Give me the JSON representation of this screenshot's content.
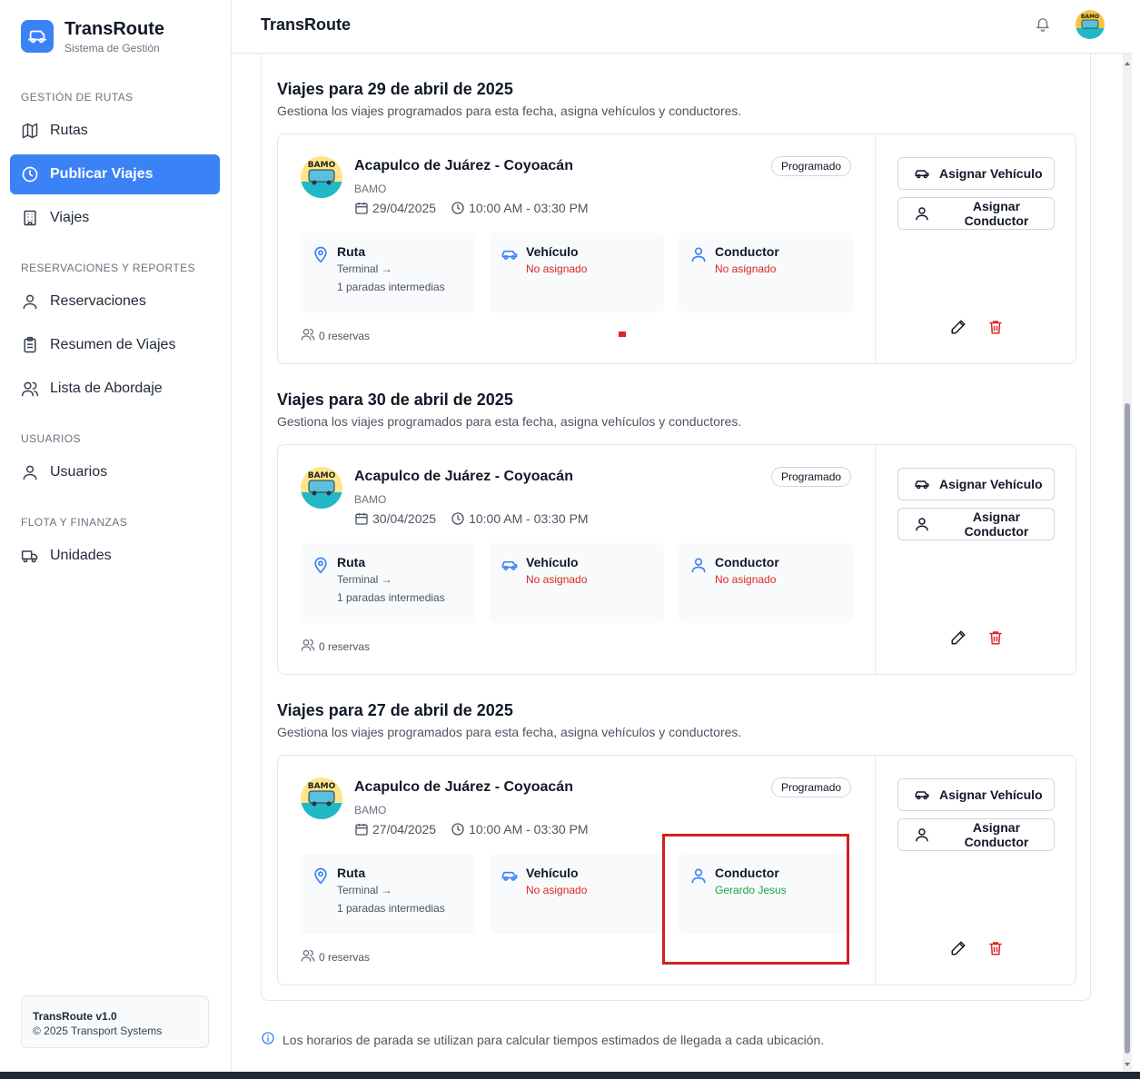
{
  "brand": {
    "title": "TransRoute",
    "subtitle": "Sistema de Gestión"
  },
  "sidebar": {
    "sections": [
      {
        "title": "GESTIÓN DE RUTAS",
        "items": [
          {
            "label": "Rutas",
            "icon": "map-icon"
          },
          {
            "label": "Publicar Viajes",
            "icon": "clock-icon",
            "active": true
          },
          {
            "label": "Viajes",
            "icon": "building-icon"
          }
        ]
      },
      {
        "title": "RESERVACIONES Y REPORTES",
        "items": [
          {
            "label": "Reservaciones",
            "icon": "user-icon"
          },
          {
            "label": "Resumen de Viajes",
            "icon": "clipboard-icon"
          },
          {
            "label": "Lista de Abordaje",
            "icon": "users-icon"
          }
        ]
      },
      {
        "title": "USUARIOS",
        "items": [
          {
            "label": "Usuarios",
            "icon": "user-icon"
          }
        ]
      },
      {
        "title": "FLOTA Y FINANZAS",
        "items": [
          {
            "label": "Unidades",
            "icon": "truck-icon"
          }
        ]
      }
    ],
    "version": {
      "line1": "TransRoute v1.0",
      "line2": "© 2025 Transport Systems"
    }
  },
  "topbar": {
    "title": "TransRoute"
  },
  "days": [
    {
      "title": "Viajes para 29 de abril de 2025",
      "subtitle": "Gestiona los viajes programados para esta fecha, asigna vehículos y conductores.",
      "trip": {
        "route": "Acapulco de Juárez - Coyoacán",
        "company": "BAMO",
        "date": "29/04/2025",
        "time": "10:00 AM - 03:30 PM",
        "status": "Programado",
        "ruta_title": "Ruta",
        "ruta_line1": "Terminal →",
        "ruta_line2": "1 paradas intermedias",
        "vehiculo_title": "Vehículo",
        "vehiculo_value": "No asignado",
        "conductor_title": "Conductor",
        "conductor_value": "No asignado",
        "reservas": "0 reservas"
      }
    },
    {
      "title": "Viajes para 30 de abril de 2025",
      "subtitle": "Gestiona los viajes programados para esta fecha, asigna vehículos y conductores.",
      "trip": {
        "route": "Acapulco de Juárez - Coyoacán",
        "company": "BAMO",
        "date": "30/04/2025",
        "time": "10:00 AM - 03:30 PM",
        "status": "Programado",
        "ruta_title": "Ruta",
        "ruta_line1": "Terminal →",
        "ruta_line2": "1 paradas intermedias",
        "vehiculo_title": "Vehículo",
        "vehiculo_value": "No asignado",
        "conductor_title": "Conductor",
        "conductor_value": "No asignado",
        "reservas": "0 reservas"
      }
    },
    {
      "title": "Viajes para 27 de abril de 2025",
      "subtitle": "Gestiona los viajes programados para esta fecha, asigna vehículos y conductores.",
      "trip": {
        "route": "Acapulco de Juárez - Coyoacán",
        "company": "BAMO",
        "date": "27/04/2025",
        "time": "10:00 AM - 03:30 PM",
        "status": "Programado",
        "ruta_title": "Ruta",
        "ruta_line1": "Terminal →",
        "ruta_line2": "1 paradas intermedias",
        "vehiculo_title": "Vehículo",
        "vehiculo_value": "No asignado",
        "conductor_title": "Conductor",
        "conductor_value": "Gerardo Jesus",
        "reservas": "0 reservas"
      }
    }
  ],
  "actions": {
    "assign_vehicle": "Asignar Vehículo",
    "assign_driver": "Asignar Conductor"
  },
  "footer_note": "Los horarios de parada se utilizan para calcular tiempos estimados de llegada a cada ubicación.",
  "colors": {
    "accent": "#3b82f6",
    "danger": "#dc2626",
    "success": "#16a34a",
    "highlight": "#d71e1e"
  }
}
